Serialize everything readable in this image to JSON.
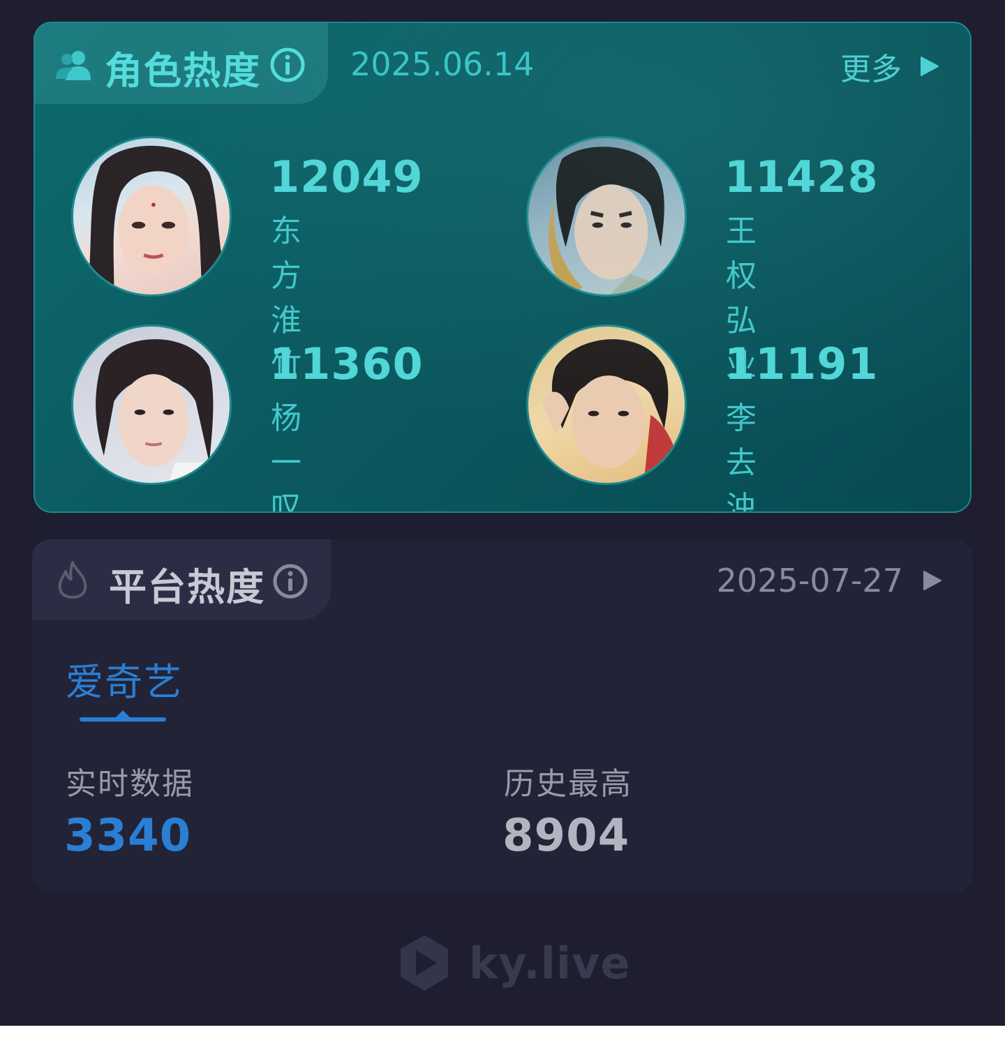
{
  "character_heat": {
    "title": "角色热度",
    "date": "2025.06.14",
    "more_label": "更多",
    "characters": [
      {
        "value": "12049",
        "name": "东方淮竹"
      },
      {
        "value": "11428",
        "name": "王权弘业"
      },
      {
        "value": "11360",
        "name": "杨一叹"
      },
      {
        "value": "11191",
        "name": "李去浊"
      }
    ]
  },
  "platform_heat": {
    "title": "平台热度",
    "date": "2025-07-27",
    "active_tab": "爱奇艺",
    "realtime": {
      "label": "实时数据",
      "value": "3340"
    },
    "history_high": {
      "label": "历史最高",
      "value": "8904"
    }
  },
  "watermark": {
    "text": "ky.live"
  },
  "colors": {
    "page_bg": "#1e1e30",
    "teal_accent": "#52d6d8",
    "blue_accent": "#2a7fd4",
    "muted_text": "#9a9aa8"
  },
  "icons": [
    "people-icon",
    "info-icon",
    "play-arrow-icon",
    "flame-icon",
    "ky-logo-icon"
  ]
}
